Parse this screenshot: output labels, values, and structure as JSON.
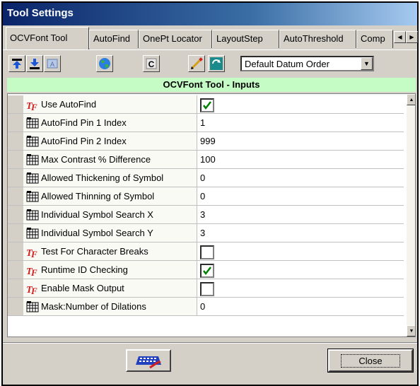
{
  "window": {
    "title": "Tool Settings"
  },
  "tabs": [
    {
      "label": "OCVFont Tool",
      "active": true
    },
    {
      "label": "AutoFind"
    },
    {
      "label": "OnePt Locator"
    },
    {
      "label": "LayoutStep"
    },
    {
      "label": "AutoThreshold"
    },
    {
      "label": "Comp"
    }
  ],
  "tab_scroll": {
    "left_icon": "arrow-left-icon",
    "right_icon": "arrow-right-icon"
  },
  "toolbar": {
    "buttons": [
      {
        "name": "move-up-button",
        "icon": "arrow-up-icon"
      },
      {
        "name": "move-down-button",
        "icon": "arrow-down-icon"
      },
      {
        "name": "text-button",
        "icon": "text-box-icon"
      },
      {
        "name": "globe-button",
        "icon": "globe-icon"
      },
      {
        "name": "c-button",
        "icon": "c-letter-icon"
      },
      {
        "name": "edit-button",
        "icon": "pencil-icon"
      },
      {
        "name": "refresh-button",
        "icon": "refresh-icon"
      }
    ],
    "datum_order": {
      "selected": "Default Datum Order"
    }
  },
  "section_header": "OCVFont Tool - Inputs",
  "properties": [
    {
      "label": "Use AutoFind",
      "type": "bool",
      "checked": true,
      "icon": "tf-icon"
    },
    {
      "label": "AutoFind Pin 1 Index",
      "type": "value",
      "value": "1",
      "icon": "grid-icon"
    },
    {
      "label": "AutoFind Pin 2 Index",
      "type": "value",
      "value": "999",
      "icon": "grid-icon"
    },
    {
      "label": "Max Contrast % Difference",
      "type": "value",
      "value": "100",
      "icon": "grid-icon"
    },
    {
      "label": "Allowed Thickening of Symbol",
      "type": "value",
      "value": "0",
      "icon": "grid-icon"
    },
    {
      "label": "Allowed Thinning of Symbol",
      "type": "value",
      "value": "0",
      "icon": "grid-icon"
    },
    {
      "label": "Individual Symbol Search X",
      "type": "value",
      "value": "3",
      "icon": "grid-icon"
    },
    {
      "label": "Individual Symbol Search Y",
      "type": "value",
      "value": "3",
      "icon": "grid-icon"
    },
    {
      "label": "Test For Character Breaks",
      "type": "bool",
      "checked": false,
      "icon": "tf-icon"
    },
    {
      "label": "Runtime ID Checking",
      "type": "bool",
      "checked": true,
      "icon": "tf-icon"
    },
    {
      "label": "Enable Mask Output",
      "type": "bool",
      "checked": false,
      "icon": "tf-icon"
    },
    {
      "label": "Mask:Number of Dilations",
      "type": "value",
      "value": "0",
      "icon": "grid-icon"
    }
  ],
  "footer": {
    "keyboard_icon": "keyboard-icon",
    "close_label": "Close"
  }
}
